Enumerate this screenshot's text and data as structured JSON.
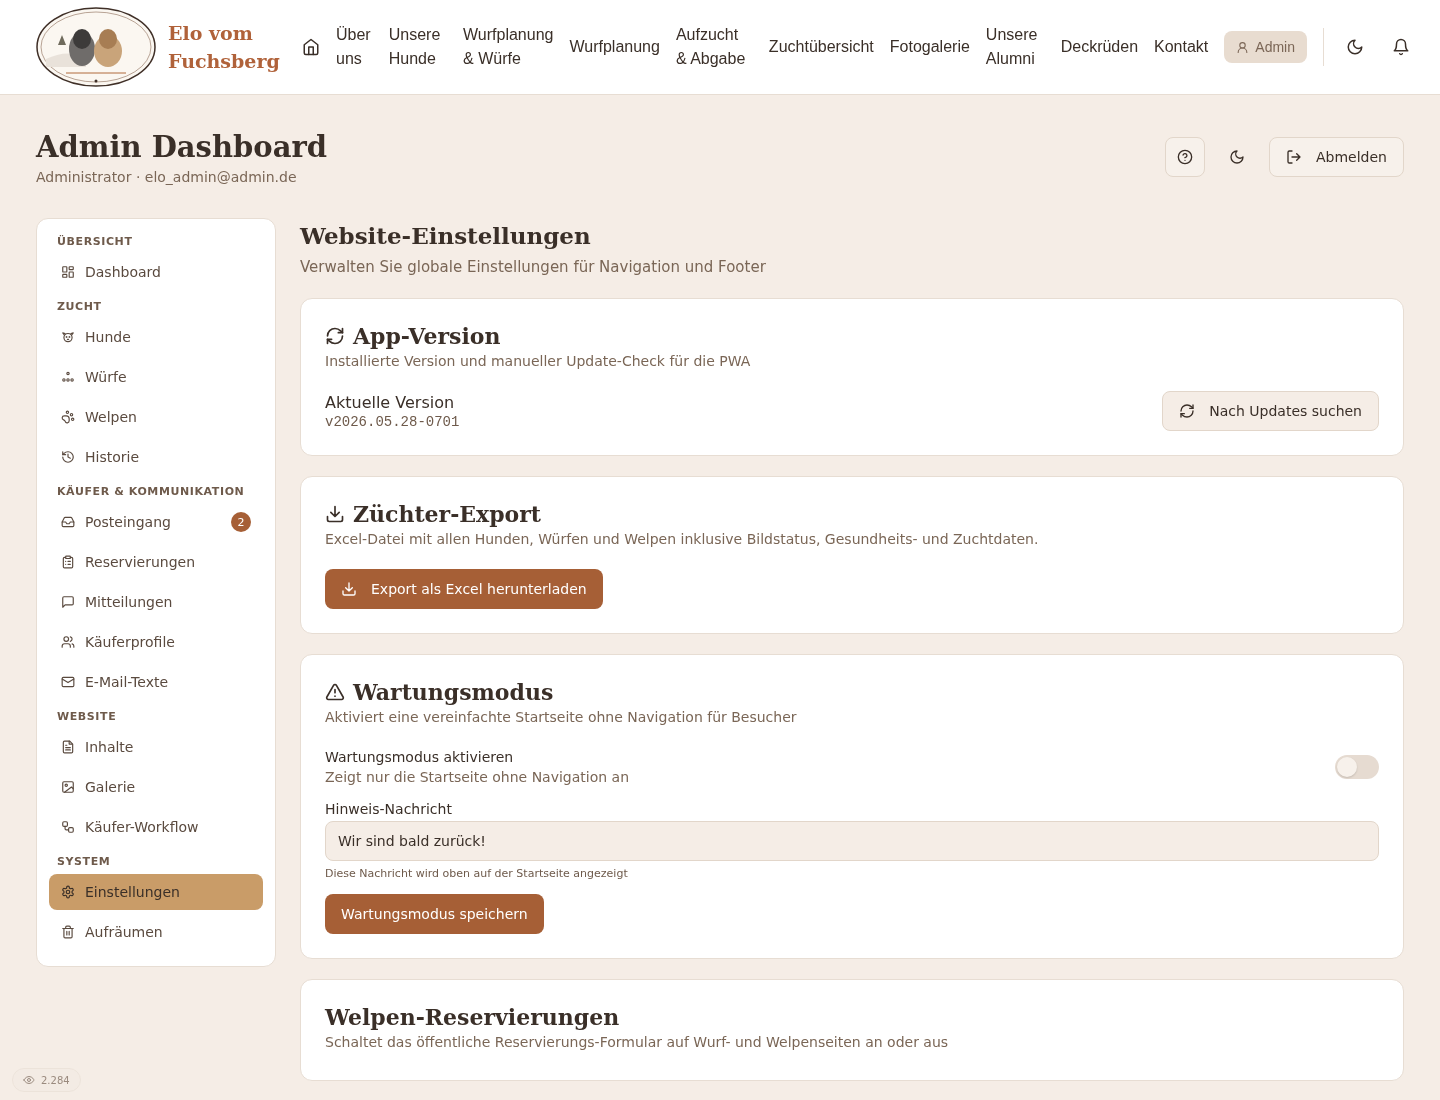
{
  "header": {
    "brand": "Elo vom Fuchsberg",
    "nav": [
      {
        "label": "Über uns"
      },
      {
        "label": "Unsere Hunde"
      },
      {
        "label": "Wurfplanung & Würfe"
      },
      {
        "label": "Wurfplanung"
      },
      {
        "label": "Aufzucht & Abgabe"
      },
      {
        "label": "Zuchtübersicht"
      },
      {
        "label": "Fotogalerie"
      },
      {
        "label": "Unsere Alumni"
      },
      {
        "label": "Deckrüden"
      },
      {
        "label": "Kontakt"
      }
    ],
    "admin_button": "Admin"
  },
  "page": {
    "title": "Admin Dashboard",
    "subtitle": "Administrator · elo_admin@admin.de",
    "logout_button": "Abmelden"
  },
  "sidebar": {
    "sections": [
      {
        "heading": "ÜBERSICHT",
        "items": [
          {
            "label": "Dashboard",
            "selected": false
          }
        ]
      },
      {
        "heading": "ZUCHT",
        "items": [
          {
            "label": "Hunde",
            "selected": false
          },
          {
            "label": "Würfe",
            "selected": false
          },
          {
            "label": "Welpen",
            "selected": false
          },
          {
            "label": "Historie",
            "selected": false
          }
        ]
      },
      {
        "heading": "KÄUFER & KOMMUNIKATION",
        "items": [
          {
            "label": "Posteingang",
            "selected": false,
            "badge": "2"
          },
          {
            "label": "Reservierungen",
            "selected": false
          },
          {
            "label": "Mitteilungen",
            "selected": false
          },
          {
            "label": "Käuferprofile",
            "selected": false
          },
          {
            "label": "E-Mail-Texte",
            "selected": false
          }
        ]
      },
      {
        "heading": "WEBSITE",
        "items": [
          {
            "label": "Inhalte",
            "selected": false
          },
          {
            "label": "Galerie",
            "selected": false
          },
          {
            "label": "Käufer-Workflow",
            "selected": false
          }
        ]
      },
      {
        "heading": "SYSTEM",
        "items": [
          {
            "label": "Einstellungen",
            "selected": true
          },
          {
            "label": "Aufräumen",
            "selected": false
          }
        ]
      }
    ]
  },
  "content": {
    "title": "Website-Einstellungen",
    "subtitle": "Verwalten Sie globale Einstellungen für Navigation und Footer",
    "cards": [
      {
        "kind": "version",
        "title": "App-Version",
        "description": "Installierte Version und manueller Update-Check für die PWA",
        "label": "Aktuelle Version",
        "value": "v2026.05.28-0701",
        "button": "Nach Updates suchen"
      },
      {
        "kind": "export",
        "title": "Züchter-Export",
        "description": "Excel-Datei mit allen Hunden, Würfen und Welpen inklusive Bildstatus, Gesundheits- und Zuchtdaten.",
        "button": "Export als Excel herunterladen"
      },
      {
        "kind": "maintenance",
        "title": "Wartungsmodus",
        "description": "Aktiviert eine vereinfachte Startseite ohne Navigation für Besucher",
        "toggle": {
          "label": "Wartungsmodus aktivieren",
          "hint": "Zeigt nur die Startseite ohne Navigation an",
          "on": false
        },
        "field": {
          "label": "Hinweis-Nachricht",
          "value": "Wir sind bald zurück!",
          "help": "Diese Nachricht wird oben auf der Startseite angezeigt"
        },
        "button": "Wartungsmodus speichern"
      },
      {
        "kind": "plain",
        "title": "Welpen-Reservierungen",
        "description": "Schaltet das öffentliche Reservierungs-Formular auf Wurf- und Welpenseiten an oder aus"
      }
    ]
  },
  "views": "2.284"
}
